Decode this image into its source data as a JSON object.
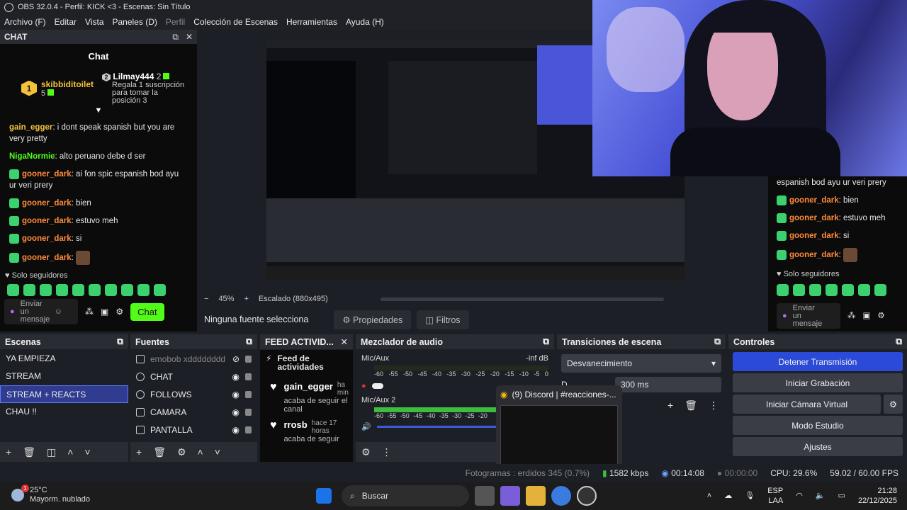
{
  "titlebar": {
    "title": "OBS 32.0.4 - Perfil: KICK <3 - Escenas: Sin Título"
  },
  "menu": {
    "items": [
      "Archivo (F)",
      "Editar",
      "Vista",
      "Paneles (D)",
      "Perfil",
      "Colección de Escenas",
      "Herramientas",
      "Ayuda (H)"
    ]
  },
  "chat": {
    "dock_title": "CHAT",
    "title": "Chat",
    "leader1_name": "skibbiditoilet",
    "leader1_count": "5",
    "leader2_name": "Lilmay444",
    "leader2_count": "2",
    "leader2_note": "Regala 1 suscripción para tomar la posición 3",
    "messages": [
      {
        "user": "gain_egger",
        "text": ": i dont speak spanish but you are very pretty"
      },
      {
        "user": "NigaNormie",
        "text": ": alto peruano debe d ser"
      },
      {
        "user": "gooner_dark",
        "text": ": ai fon spic espanish bod ayu ur veri prery"
      },
      {
        "user": "gooner_dark",
        "text": ": bien"
      },
      {
        "user": "gooner_dark",
        "text": ": estuvo meh"
      },
      {
        "user": "gooner_dark",
        "text": ": si"
      },
      {
        "user": "gooner_dark",
        "text": ":"
      }
    ],
    "followers_only": "Solo seguidores",
    "input_placeholder": "Enviar un mensaje",
    "send_label": "Chat"
  },
  "chat_right": {
    "messages": [
      {
        "user": "",
        "text": "espanish bod ayu ur veri prery"
      },
      {
        "user": "gooner_dark",
        "text": ": bien"
      },
      {
        "user": "gooner_dark",
        "text": ": estuvo meh"
      },
      {
        "user": "gooner_dark",
        "text": ": si"
      },
      {
        "user": "gooner_dark",
        "text": ":"
      }
    ],
    "followers_only": "Solo seguidores",
    "input_placeholder": "Enviar un mensaje"
  },
  "preview": {
    "zoom": "45%",
    "scaling": "Escalado (880x495)",
    "no_source": "Ninguna fuente selecciona",
    "properties": "Propiedades",
    "filters": "Filtros"
  },
  "scenes": {
    "title": "Escenas",
    "items": [
      "YA EMPIEZA",
      "STREAM",
      "STREAM + REACTS",
      "CHAU !!"
    ],
    "selected": "STREAM + REACTS"
  },
  "sources": {
    "title": "Fuentes",
    "items": [
      "emobob xdddddddd",
      "CHAT",
      "FOLLOWS",
      "CAMARA",
      "PANTALLA"
    ]
  },
  "feed": {
    "title": "FEED ACTIVID...",
    "heading": "Feed de actividades",
    "items": [
      {
        "user": "gain_egger",
        "time": "ha min",
        "desc": "acaba de seguir el canal"
      },
      {
        "user": "rrosb",
        "time": "hace 17 horas",
        "desc": "acaba de seguir"
      }
    ]
  },
  "mixer": {
    "title": "Mezclador de audio",
    "track1": "Mic/Aux",
    "track1_db": "-inf dB",
    "track2": "Mic/Aux 2",
    "scale": [
      "-60",
      "-55",
      "-50",
      "-45",
      "-40",
      "-35",
      "-30",
      "-25",
      "-20",
      "-15",
      "-10",
      "-5",
      "0"
    ]
  },
  "transitions": {
    "title": "Transiciones de escena",
    "selected": "Desvanecimiento",
    "duration_label": "D",
    "duration_value": "300 ms"
  },
  "controls": {
    "title": "Controles",
    "stop_stream": "Detener Transmisión",
    "start_recording": "Iniciar Grabación",
    "start_virtual_cam": "Iniciar Cámara Virtual",
    "studio_mode": "Modo Estudio",
    "settings": "Ajustes"
  },
  "discord_popup": {
    "title": "(9) Discord | #reacciones-..."
  },
  "status": {
    "frames": "Fotogramas : erdidos 345 (0.7%)",
    "bitrate": "1582 kbps",
    "stream_time": "00:14:08",
    "rec_time": "00:00:00",
    "cpu": "CPU: 29.6%",
    "fps": "59.02 / 60.00 FPS"
  },
  "taskbar": {
    "temp": "25°C",
    "weather": "Mayorm. nublado",
    "weather_badge": "1",
    "search": "Buscar",
    "lang1": "ESP",
    "lang2": "LAA",
    "time": "21:28",
    "date": "22/12/2025"
  },
  "colors": {
    "kick_green": "#53fc18",
    "accent_blue": "#2b4ad7",
    "selected_scene": "#2f3c8f"
  }
}
